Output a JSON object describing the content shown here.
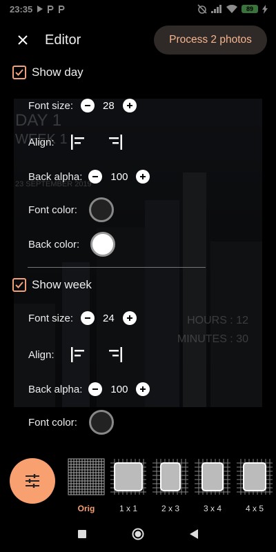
{
  "status_bar": {
    "time": "23:35",
    "battery": "89"
  },
  "header": {
    "title": "Editor",
    "process_button": "Process 2 photos"
  },
  "preview": {
    "day_text": "DAY 1",
    "week_text": "WEEK 1",
    "date_text": "23 SEPTEMBER 2019",
    "hours_text": "HOURS : 12",
    "minutes_text": "MINUTES : 30"
  },
  "day_section": {
    "checkbox_label": "Show day",
    "checked": true,
    "font_size_label": "Font size:",
    "font_size_value": "28",
    "align_label": "Align:",
    "back_alpha_label": "Back alpha:",
    "back_alpha_value": "100",
    "font_color_label": "Font color:",
    "font_color": "#222222",
    "back_color_label": "Back color:",
    "back_color": "#ffffff"
  },
  "week_section": {
    "checkbox_label": "Show week",
    "checked": true,
    "font_size_label": "Font size:",
    "font_size_value": "24",
    "align_label": "Align:",
    "back_alpha_label": "Back alpha:",
    "back_alpha_value": "100",
    "font_color_label": "Font color:",
    "font_color": "#222222"
  },
  "grid_options": [
    {
      "label": "Orig",
      "active": true
    },
    {
      "label": "1 x 1",
      "active": false
    },
    {
      "label": "2 x 3",
      "active": false
    },
    {
      "label": "3 x 4",
      "active": false
    },
    {
      "label": "4 x 5",
      "active": false
    }
  ],
  "colors": {
    "accent": "#f8a070",
    "process_text": "#f6b58e",
    "process_bg": "#2f2a28"
  }
}
